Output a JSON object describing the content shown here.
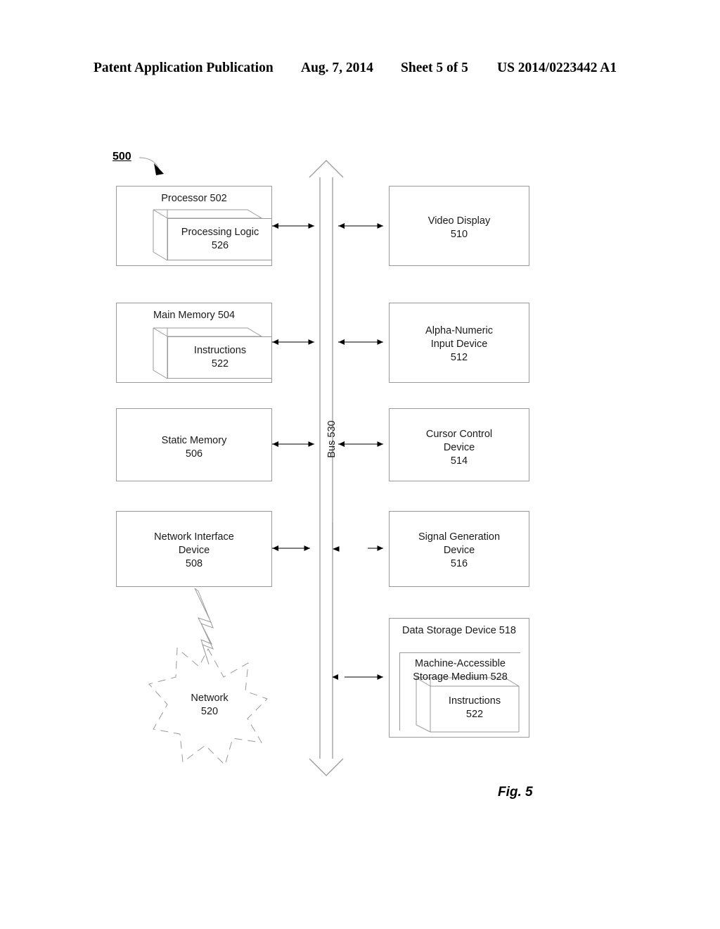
{
  "page": {
    "header": {
      "publication": "Patent Application Publication",
      "date": "Aug. 7, 2014",
      "sheet": "Sheet 5 of 5",
      "patent_number": "US 2014/0223442 A1"
    },
    "figure_caption": "Fig. 5",
    "background_color": "#ffffff",
    "line_color": "#9a9a9a",
    "text_color": "#1a1a1a"
  },
  "diagram": {
    "reference_numeral": "500",
    "bus": {
      "label": "Bus 530"
    },
    "left_column": [
      {
        "id": "processor",
        "title": "Processor 502",
        "inner": {
          "line1": "Processing Logic",
          "line2": "526"
        }
      },
      {
        "id": "main-memory",
        "title": "Main Memory 504",
        "inner": {
          "line1": "Instructions",
          "line2": "522"
        }
      },
      {
        "id": "static-memory",
        "line1": "Static Memory",
        "line2": "506"
      },
      {
        "id": "network-interface-device",
        "line1": "Network Interface",
        "line2": "Device",
        "line3": "508"
      }
    ],
    "right_column": [
      {
        "id": "video-display",
        "line1": "Video Display",
        "line2": "510"
      },
      {
        "id": "alpha-numeric-input-device",
        "line1": "Alpha-Numeric",
        "line2": "Input Device",
        "line3": "512"
      },
      {
        "id": "cursor-control-device",
        "line1": "Cursor Control",
        "line2": "Device",
        "line3": "514"
      },
      {
        "id": "signal-generation-device",
        "line1": "Signal Generation",
        "line2": "Device",
        "line3": "516"
      },
      {
        "id": "data-storage-device",
        "title": "Data Storage Device 518",
        "medium": {
          "line1": "Machine-Accessible",
          "line2": "Storage Medium 528"
        },
        "inner": {
          "line1": "Instructions",
          "line2": "522"
        }
      }
    ],
    "network": {
      "line1": "Network",
      "line2": "520"
    }
  }
}
